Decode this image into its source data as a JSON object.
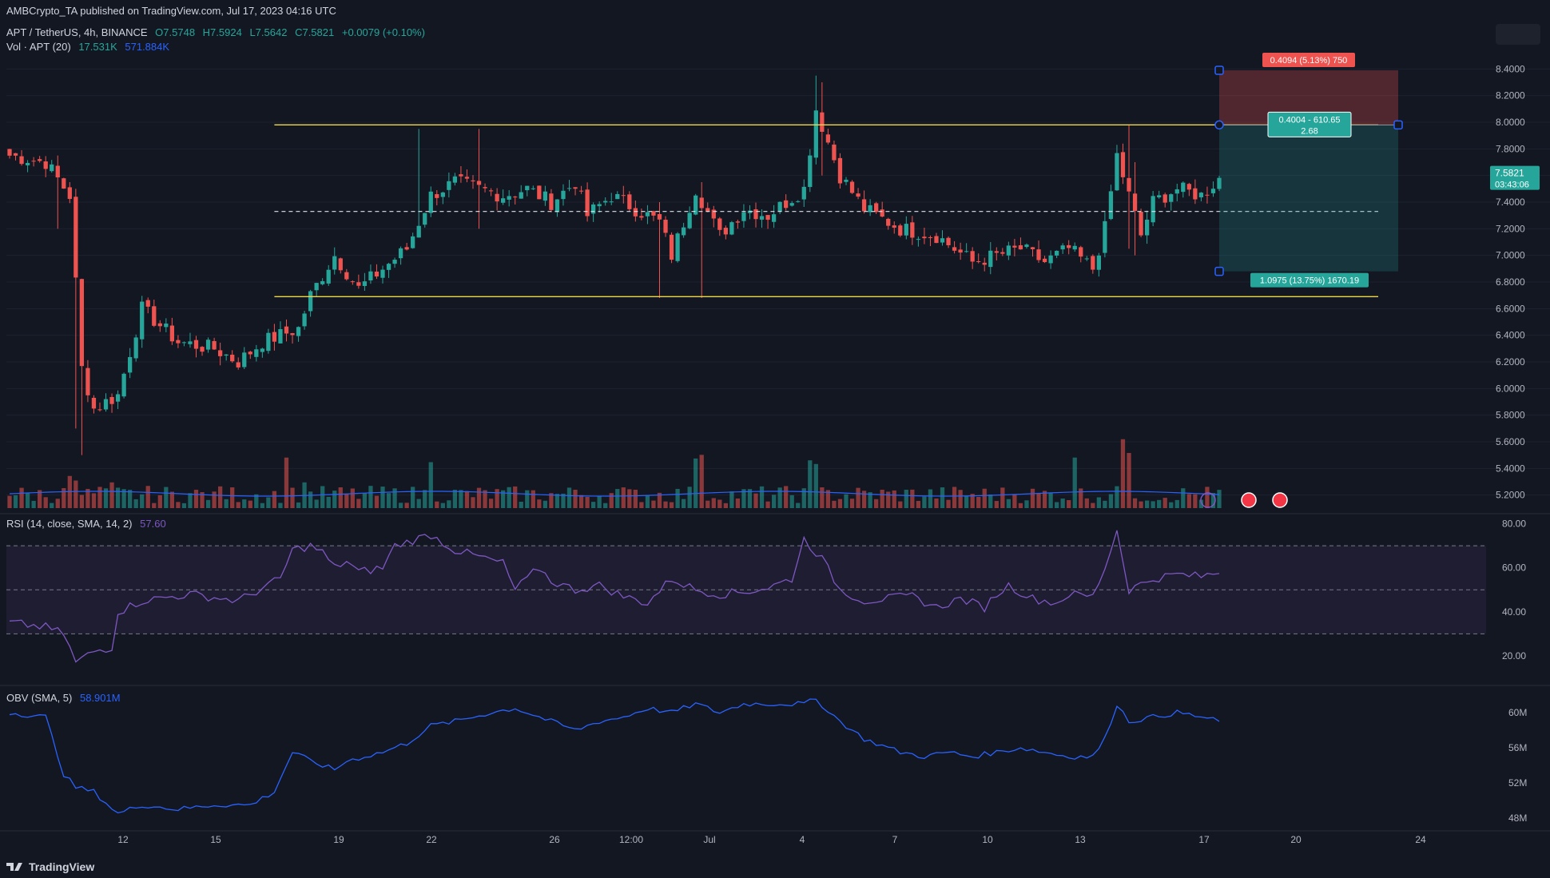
{
  "publisher": "AMBCrypto_TA published on TradingView.com, Jul 17, 2023 04:16 UTC",
  "symbol_line": {
    "symbol": "APT / TetherUS, 4h, BINANCE",
    "open": "O7.5748",
    "high": "H7.5924",
    "low": "L7.5642",
    "close": "C7.5821",
    "change": "+0.0079 (+0.10%)"
  },
  "volume_line": {
    "label": "Vol · APT (20)",
    "v1": "17.531K",
    "v2": "571.884K"
  },
  "rsi_line": {
    "label": "RSI (14, close, SMA, 14, 2)",
    "value": "57.60"
  },
  "obv_line": {
    "label": "OBV (SMA, 5)",
    "value": "58.901M"
  },
  "brand": "TradingView",
  "colors": {
    "bg": "#131722",
    "up": "#26a69a",
    "down": "#ef5350",
    "rsi": "#7e57c2",
    "obv": "#2962ff",
    "range": "#f0d84a",
    "grid": "#1e2230",
    "text": "#b2b5be"
  },
  "chart_data": [
    {
      "type": "candlestick",
      "title": "APT / TetherUS, 4h, BINANCE",
      "price_ticks": [
        "8.4000",
        "8.2000",
        "8.0000",
        "7.8000",
        "7.6000",
        "7.4000",
        "7.2000",
        "7.0000",
        "6.8000",
        "6.6000",
        "6.4000",
        "6.2000",
        "6.0000",
        "5.8000",
        "5.6000",
        "5.4000",
        "5.2000"
      ],
      "ylim": [
        5.15,
        8.45
      ],
      "x_ticks": [
        "12",
        "15",
        "19",
        "22",
        "26",
        "12:00",
        "Jul",
        "4",
        "7",
        "10",
        "13",
        "17",
        "20",
        "24"
      ],
      "last_price": "7.5821",
      "countdown": "03:43:06",
      "range_high": 7.98,
      "range_mid": 7.33,
      "range_low": 6.69,
      "position": {
        "entry": 7.98,
        "stop": 8.39,
        "target": 6.88,
        "stop_label": "0.4094 (5.13%) 750",
        "ratio_label_1": "0.4004 - 610.65",
        "ratio_label_2": "2.68",
        "target_label": "1.0975 (13.75%) 1670.19"
      },
      "close_anchors": [
        [
          0,
          7.75
        ],
        [
          6,
          7.7
        ],
        [
          10,
          7.45
        ],
        [
          12,
          6.15
        ],
        [
          14,
          5.85
        ],
        [
          18,
          5.95
        ],
        [
          22,
          6.6
        ],
        [
          28,
          6.35
        ],
        [
          34,
          6.3
        ],
        [
          38,
          6.2
        ],
        [
          42,
          6.35
        ],
        [
          48,
          6.45
        ],
        [
          50,
          6.7
        ],
        [
          54,
          7.0
        ],
        [
          58,
          6.75
        ],
        [
          62,
          6.9
        ],
        [
          66,
          7.05
        ],
        [
          70,
          7.45
        ],
        [
          74,
          7.55
        ],
        [
          78,
          7.5
        ],
        [
          82,
          7.45
        ],
        [
          86,
          7.5
        ],
        [
          90,
          7.4
        ],
        [
          94,
          7.55
        ],
        [
          96,
          7.3
        ],
        [
          100,
          7.45
        ],
        [
          104,
          7.35
        ],
        [
          108,
          7.25
        ],
        [
          110,
          7.0
        ],
        [
          114,
          7.5
        ],
        [
          118,
          7.15
        ],
        [
          122,
          7.35
        ],
        [
          126,
          7.3
        ],
        [
          132,
          7.5
        ],
        [
          134,
          8.1
        ],
        [
          138,
          7.6
        ],
        [
          142,
          7.35
        ],
        [
          148,
          7.2
        ],
        [
          154,
          7.15
        ],
        [
          160,
          6.95
        ],
        [
          164,
          7.0
        ],
        [
          168,
          7.05
        ],
        [
          172,
          6.95
        ],
        [
          176,
          7.05
        ],
        [
          180,
          6.9
        ],
        [
          182,
          7.2
        ],
        [
          184,
          7.75
        ],
        [
          186,
          7.45
        ],
        [
          188,
          7.15
        ],
        [
          190,
          7.4
        ],
        [
          194,
          7.5
        ],
        [
          198,
          7.45
        ],
        [
          201,
          7.58
        ]
      ],
      "wick_overrides": [
        [
          8,
          7.2,
          7.75
        ],
        [
          11,
          5.7,
          7.5
        ],
        [
          12,
          5.5,
          6.6
        ],
        [
          68,
          7.3,
          7.95
        ],
        [
          78,
          7.2,
          7.95
        ],
        [
          108,
          6.68,
          7.4
        ],
        [
          115,
          6.68,
          7.55
        ],
        [
          134,
          7.8,
          8.35
        ],
        [
          135,
          7.6,
          8.3
        ],
        [
          186,
          7.05,
          7.98
        ],
        [
          187,
          7.0,
          7.7
        ]
      ]
    },
    {
      "type": "bar",
      "title": "Vol · APT (20)",
      "ma": "17.531K",
      "value": "571.884K",
      "spikes": [
        [
          1,
          14
        ],
        [
          10,
          35
        ],
        [
          11,
          30
        ],
        [
          17,
          28
        ],
        [
          34,
          18
        ],
        [
          46,
          55
        ],
        [
          49,
          28
        ],
        [
          70,
          50
        ],
        [
          94,
          20
        ],
        [
          104,
          20
        ],
        [
          114,
          54
        ],
        [
          115,
          58
        ],
        [
          133,
          52
        ],
        [
          134,
          48
        ],
        [
          177,
          55
        ],
        [
          185,
          75
        ],
        [
          186,
          60
        ]
      ]
    },
    {
      "type": "line",
      "title": "RSI (14, close, SMA, 14, 2)",
      "value": "57.60",
      "y_ticks": [
        "80.00",
        "60.00",
        "40.00",
        "20.00"
      ],
      "ylim": [
        12,
        82
      ],
      "bands": [
        70,
        50,
        30
      ],
      "anchors": [
        [
          0,
          35
        ],
        [
          6,
          33
        ],
        [
          9,
          30
        ],
        [
          11,
          17
        ],
        [
          14,
          22
        ],
        [
          17,
          24
        ],
        [
          18,
          40
        ],
        [
          22,
          45
        ],
        [
          30,
          48
        ],
        [
          38,
          45
        ],
        [
          45,
          55
        ],
        [
          47,
          68
        ],
        [
          50,
          70
        ],
        [
          52,
          67
        ],
        [
          54,
          60
        ],
        [
          56,
          63
        ],
        [
          58,
          58
        ],
        [
          62,
          60
        ],
        [
          64,
          70
        ],
        [
          70,
          75
        ],
        [
          74,
          68
        ],
        [
          78,
          65
        ],
        [
          82,
          62
        ],
        [
          84,
          50
        ],
        [
          88,
          60
        ],
        [
          90,
          54
        ],
        [
          94,
          50
        ],
        [
          98,
          52
        ],
        [
          102,
          47
        ],
        [
          106,
          44
        ],
        [
          110,
          55
        ],
        [
          114,
          50
        ],
        [
          118,
          48
        ],
        [
          122,
          49
        ],
        [
          126,
          51
        ],
        [
          130,
          55
        ],
        [
          132,
          73
        ],
        [
          135,
          64
        ],
        [
          138,
          50
        ],
        [
          142,
          45
        ],
        [
          146,
          46
        ],
        [
          150,
          47
        ],
        [
          154,
          42
        ],
        [
          158,
          46
        ],
        [
          162,
          42
        ],
        [
          164,
          48
        ],
        [
          166,
          52
        ],
        [
          170,
          46
        ],
        [
          174,
          44
        ],
        [
          176,
          48
        ],
        [
          180,
          47
        ],
        [
          182,
          60
        ],
        [
          184,
          77
        ],
        [
          186,
          50
        ],
        [
          190,
          55
        ],
        [
          194,
          57
        ],
        [
          198,
          56
        ],
        [
          201,
          58
        ]
      ]
    },
    {
      "type": "line",
      "title": "OBV (SMA, 5)",
      "value": "58.901M",
      "y_ticks": [
        "60M",
        "56M",
        "52M",
        "48M"
      ],
      "ylim": [
        47,
        62
      ],
      "anchors": [
        [
          0,
          60
        ],
        [
          6,
          59.5
        ],
        [
          9,
          53
        ],
        [
          11,
          51.5
        ],
        [
          14,
          51
        ],
        [
          18,
          48.5
        ],
        [
          22,
          49.5
        ],
        [
          28,
          49
        ],
        [
          34,
          49.5
        ],
        [
          40,
          49.5
        ],
        [
          44,
          51
        ],
        [
          47,
          55.5
        ],
        [
          50,
          54.5
        ],
        [
          54,
          53.5
        ],
        [
          56,
          54.5
        ],
        [
          62,
          55.5
        ],
        [
          66,
          56.5
        ],
        [
          70,
          58.5
        ],
        [
          74,
          59
        ],
        [
          80,
          60
        ],
        [
          84,
          60.5
        ],
        [
          90,
          59
        ],
        [
          94,
          58
        ],
        [
          98,
          59
        ],
        [
          102,
          59.5
        ],
        [
          106,
          60.5
        ],
        [
          110,
          60
        ],
        [
          114,
          61
        ],
        [
          118,
          60
        ],
        [
          122,
          61
        ],
        [
          126,
          61
        ],
        [
          132,
          61
        ],
        [
          134,
          61.5
        ],
        [
          138,
          59
        ],
        [
          142,
          57
        ],
        [
          148,
          55.5
        ],
        [
          152,
          55
        ],
        [
          156,
          55.5
        ],
        [
          160,
          55
        ],
        [
          164,
          55.5
        ],
        [
          168,
          56
        ],
        [
          172,
          55.5
        ],
        [
          176,
          55
        ],
        [
          180,
          55
        ],
        [
          182,
          57
        ],
        [
          184,
          61
        ],
        [
          186,
          59
        ],
        [
          190,
          59.5
        ],
        [
          194,
          60
        ],
        [
          198,
          59.5
        ],
        [
          201,
          59
        ]
      ]
    }
  ]
}
